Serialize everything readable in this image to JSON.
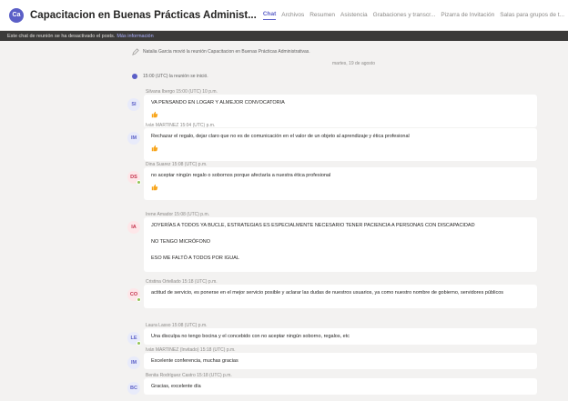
{
  "header": {
    "team_initials": "Ca",
    "title": "Capacitacion en Buenas Prácticas Administ...",
    "tabs": [
      "Chat",
      "Archivos",
      "Resumen",
      "Asistencia",
      "Grabaciones y transcr...",
      "Pizarra de Invitación",
      "Salas para grupos de t..."
    ]
  },
  "banner": {
    "text": "Este chat de reunión se ha desactivado el posts.",
    "link": "Más información"
  },
  "system_message": "Natalia Garcia movió la reunión Capacitacion en Buenas Prácticas Administrativas.",
  "date_separator": "martes, 19 de agosto",
  "meeting_started": "15:00 (UTC) la reunión se inició.",
  "messages": [
    {
      "initials": "SI",
      "meta": "Silvana Ibergo  15:00 (UTC) 10 p.m.",
      "lines": [
        "VA PENSANDO EN LOGAR Y ALMEJOR CONVOCATORIA"
      ],
      "reaction": true,
      "avatar_bg": "#e8ebfa",
      "avatar_fg": "#5b5fc7",
      "online": false
    },
    {
      "initials": "IM",
      "meta": "Iván MARTINEZ  15:04 (UTC) p.m.",
      "lines": [
        "Rechazar el regalo, dejar claro que no es de comunicación en el valor de un objeto al aprendizaje y ética profesional"
      ],
      "reaction": true,
      "avatar_bg": "#e8ebfa",
      "avatar_fg": "#5b5fc7",
      "online": false
    },
    {
      "initials": "DS",
      "meta": "Dina Suarez  15:08 (UTC) p.m.",
      "lines": [
        "no aceptar ningún regalo o sobornos porque afectaría a nuestra ética profesional"
      ],
      "reaction": true,
      "avatar_bg": "#fde7e9",
      "avatar_fg": "#c4314b",
      "online": true
    },
    {
      "initials": "IA",
      "meta": "Irene Amador  15:08 (UTC) p.m.",
      "lines": [
        "JOYERÍAS A TODOS YA BUCLE, ESTRATEGIAS ES ESPECIALMENTE NECESARIO TENER PACIENCIA A PERSONAS CON DISCAPACIDAD",
        "NO TENGO MICRÓFONO",
        "ESO ME FALTÓ A TODOS POR IGUAL"
      ],
      "reaction": false,
      "avatar_bg": "#fde7e9",
      "avatar_fg": "#c4314b",
      "online": false
    },
    {
      "initials": "CO",
      "meta": "Cristina Ortellado  15:18 (UTC) p.m.",
      "lines": [
        "actitud de servicio, es ponerse en el mejor servicio posible y aclarar las dudas de nuestros usuarios, ya como nuestro nombre de gobierno, servidores públicos"
      ],
      "reaction": false,
      "avatar_bg": "#fde7e9",
      "avatar_fg": "#c4314b",
      "online": true
    },
    {
      "initials": "LE",
      "meta": "Laura Lasso  15:08 (UTC) p.m.",
      "lines": [
        "Una disculpa no tengo bocina y el concebido con no aceptar ningún soborno, regalos, etc"
      ],
      "reaction": false,
      "avatar_bg": "#e8ebfa",
      "avatar_fg": "#5b5fc7",
      "online": true
    },
    {
      "initials": "IM",
      "meta": "Iván MARTINEZ (Invitado)  15:18 (UTC) p.m.",
      "lines": [
        "Excelente conferencia, muchas gracias"
      ],
      "reaction": false,
      "avatar_bg": "#e8ebfa",
      "avatar_fg": "#5b5fc7",
      "online": false
    },
    {
      "initials": "BC",
      "meta": "Benita Rodríguez Castro  15:18 (UTC) p.m.",
      "lines": [
        "Gracias, excelente día"
      ],
      "reaction": false,
      "avatar_bg": "#e8ebfa",
      "avatar_fg": "#5b5fc7",
      "online": false
    }
  ],
  "colors": {
    "accent": "#5b5fc7",
    "reaction": "#f8a51b",
    "background": "#f3f2f1",
    "bubble": "#ffffff"
  },
  "icons": {
    "edit": "pencil-icon",
    "reaction": "thumbs-up-icon"
  }
}
